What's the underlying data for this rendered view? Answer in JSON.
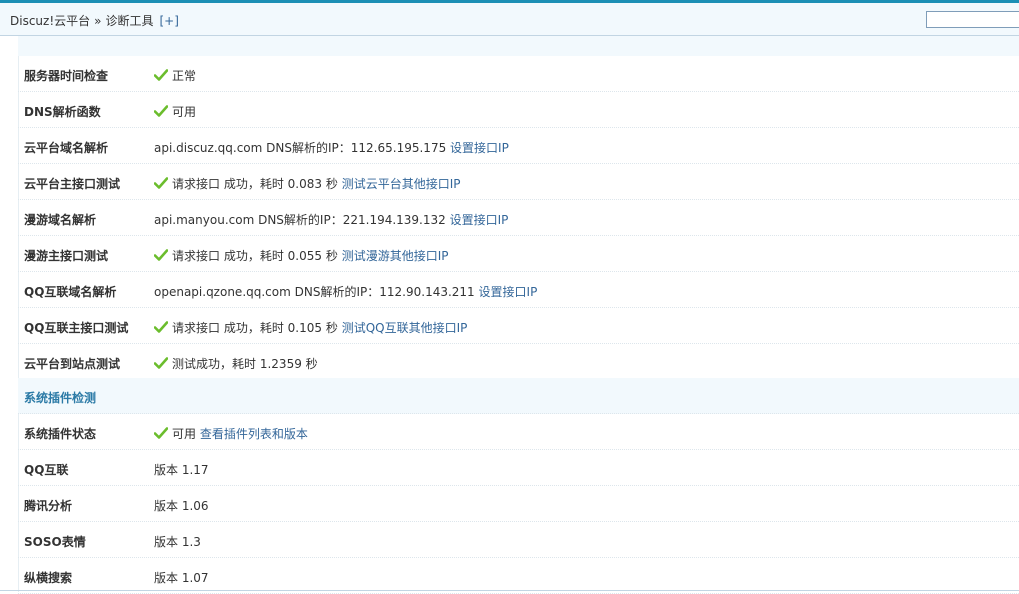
{
  "breadcrumb": {
    "root": "Discuz!云平台",
    "separator": "»",
    "current": "诊断工具",
    "add": "[+]"
  },
  "search": {
    "value": ""
  },
  "rows": [
    {
      "label": "服务器时间检查",
      "status": "正常"
    },
    {
      "label": "DNS解析函数",
      "status": "可用"
    },
    {
      "label": "云平台域名解析",
      "host": "api.discuz.qq.com",
      "dns_text": "DNS解析的IP：",
      "ip": "112.65.195.175",
      "link": "设置接口IP"
    },
    {
      "label": "云平台主接口测试",
      "text": "请求接口 成功，耗时",
      "time": "0.083",
      "unit": "秒",
      "link": "测试云平台其他接口IP"
    },
    {
      "label": "漫游域名解析",
      "host": "api.manyou.com",
      "dns_text": "DNS解析的IP：",
      "ip": "221.194.139.132",
      "link": "设置接口IP"
    },
    {
      "label": "漫游主接口测试",
      "text": "请求接口 成功，耗时",
      "time": "0.055",
      "unit": "秒",
      "link": "测试漫游其他接口IP"
    },
    {
      "label": "QQ互联域名解析",
      "host": "openapi.qzone.qq.com",
      "dns_text": "DNS解析的IP：",
      "ip": "112.90.143.211",
      "link": "设置接口IP"
    },
    {
      "label": "QQ互联主接口测试",
      "text": "请求接口 成功，耗时",
      "time": "0.105",
      "unit": "秒",
      "link": "测试QQ互联其他接口IP"
    },
    {
      "label": "云平台到站点测试",
      "text": "测试成功，耗时",
      "time": "1.2359",
      "unit": "秒"
    }
  ],
  "plugin_section": {
    "title": "系统插件检测",
    "rows": [
      {
        "label": "系统插件状态",
        "status": "可用",
        "link": "查看插件列表和版本"
      },
      {
        "label": "QQ互联",
        "version_label": "版本",
        "version": "1.17"
      },
      {
        "label": "腾讯分析",
        "version_label": "版本",
        "version": "1.06"
      },
      {
        "label": "SOSO表情",
        "version_label": "版本",
        "version": "1.3"
      },
      {
        "label": "纵横搜索",
        "version_label": "版本",
        "version": "1.07"
      }
    ]
  },
  "colors": {
    "accent": "#1c8fb5",
    "header_bg": "#f2f9fd",
    "link": "#336699",
    "section_title": "#2b7aa6",
    "check": "#6bbd2d"
  },
  "icons": {
    "status": "check-icon"
  }
}
